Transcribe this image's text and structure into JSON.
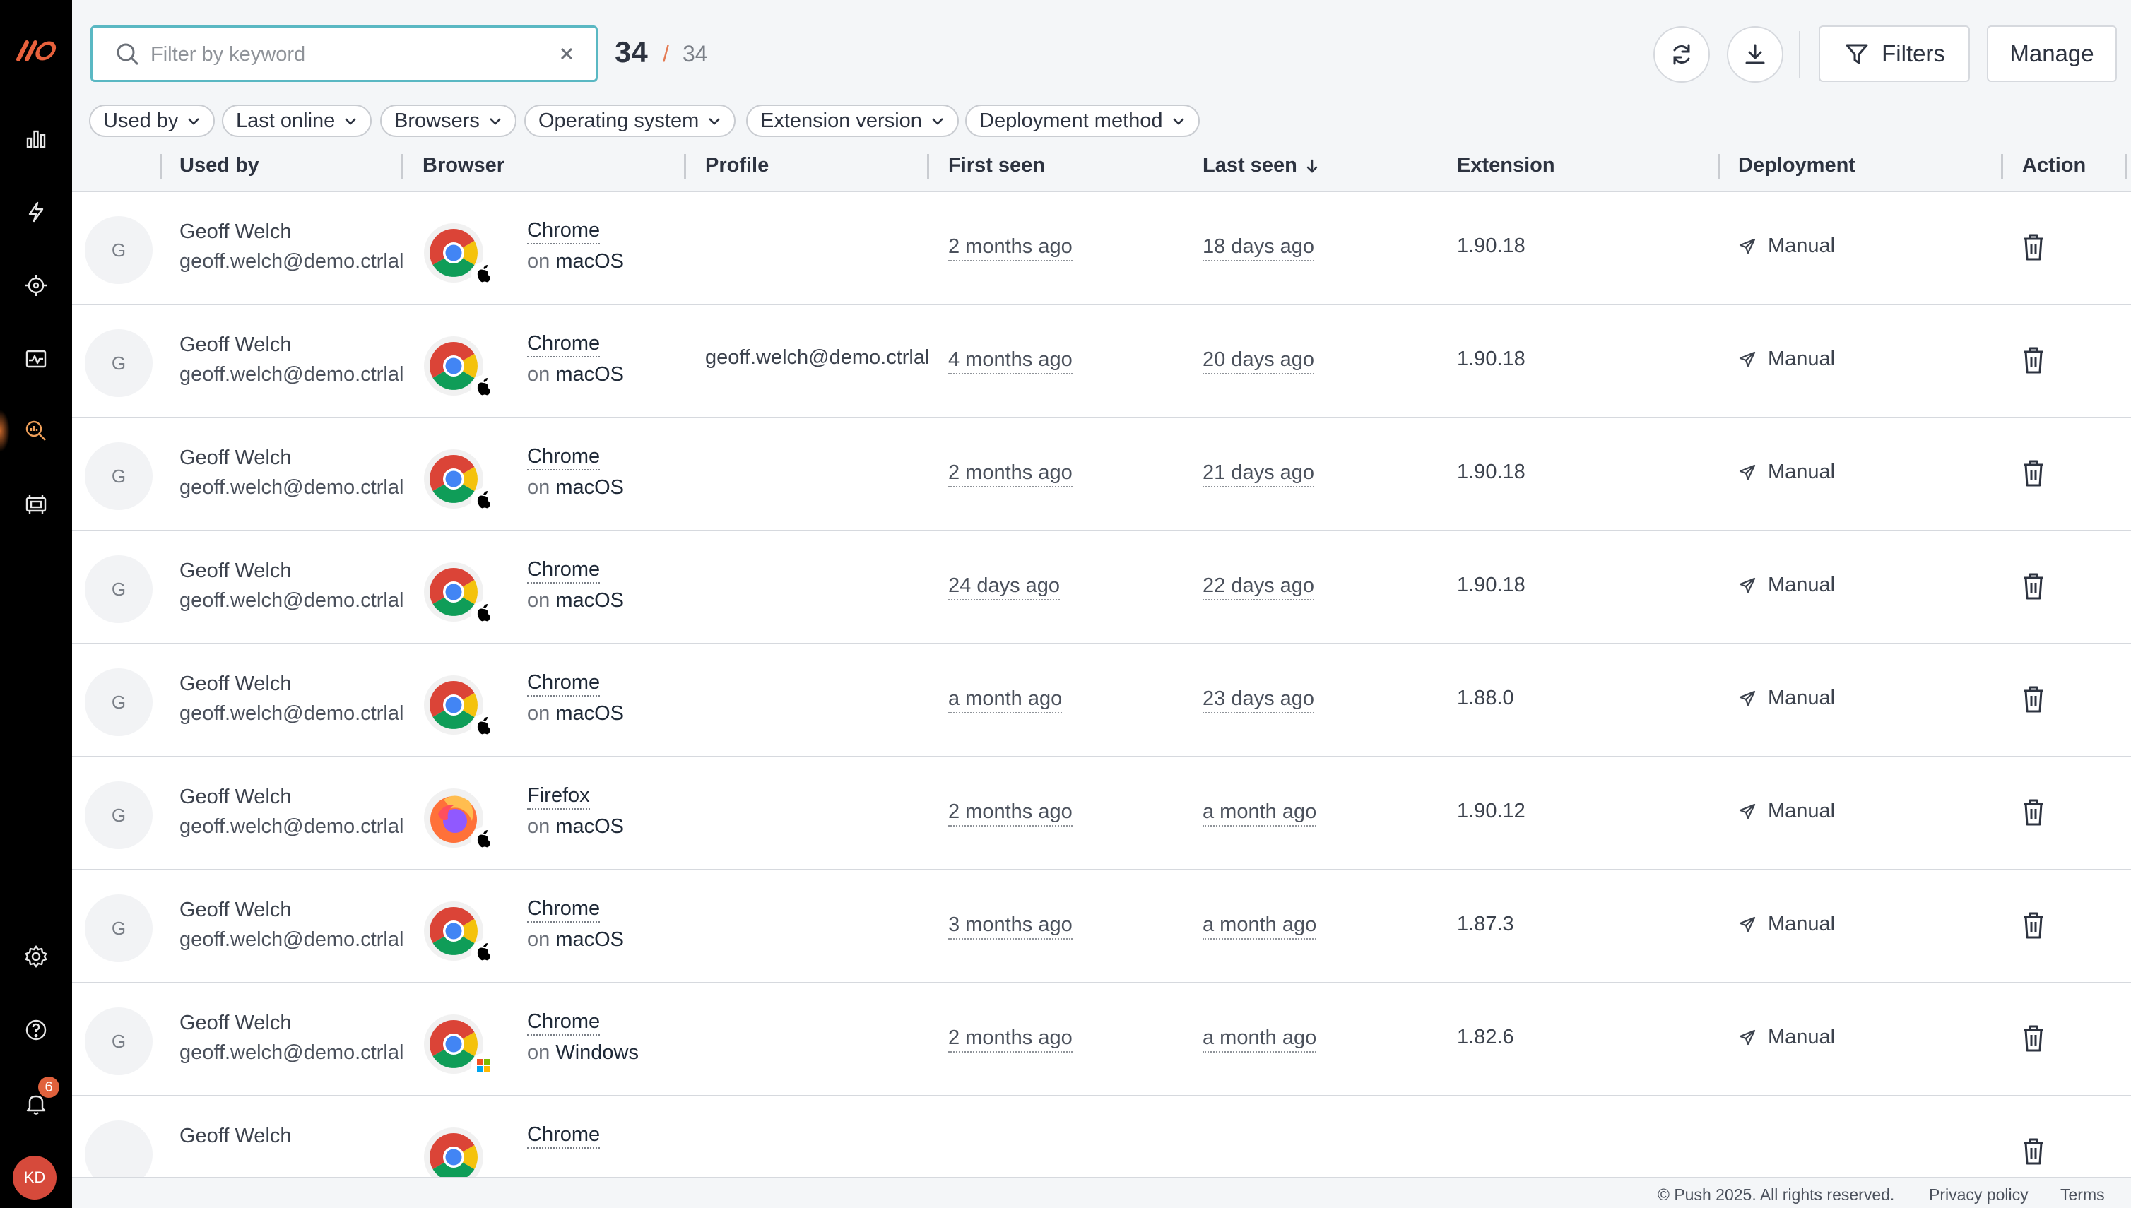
{
  "search": {
    "placeholder": "Filter by keyword",
    "value": ""
  },
  "counts": {
    "shown": "34",
    "separator": "/",
    "total": "34"
  },
  "toolbar": {
    "filters_label": "Filters",
    "manage_label": "Manage"
  },
  "filter_chips": [
    "Used by",
    "Last online",
    "Browsers",
    "Operating system",
    "Extension version",
    "Deployment method"
  ],
  "columns": {
    "used_by": "Used by",
    "browser": "Browser",
    "profile": "Profile",
    "first_seen": "First seen",
    "last_seen": "Last seen",
    "extension": "Extension",
    "deployment": "Deployment",
    "action": "Action"
  },
  "rows": [
    {
      "avatar": "G",
      "name": "Geoff Welch",
      "email": "geoff.welch@demo.ctrlal",
      "browser": "Chrome",
      "on": "on",
      "os": "macOS",
      "profile": "",
      "first_seen": "2 months ago",
      "last_seen": "18 days ago",
      "extension": "1.90.18",
      "deployment": "Manual"
    },
    {
      "avatar": "G",
      "name": "Geoff Welch",
      "email": "geoff.welch@demo.ctrlal",
      "browser": "Chrome",
      "on": "on",
      "os": "macOS",
      "profile": "geoff.welch@demo.ctrlal",
      "first_seen": "4 months ago",
      "last_seen": "20 days ago",
      "extension": "1.90.18",
      "deployment": "Manual"
    },
    {
      "avatar": "G",
      "name": "Geoff Welch",
      "email": "geoff.welch@demo.ctrlal",
      "browser": "Chrome",
      "on": "on",
      "os": "macOS",
      "profile": "",
      "first_seen": "2 months ago",
      "last_seen": "21 days ago",
      "extension": "1.90.18",
      "deployment": "Manual"
    },
    {
      "avatar": "G",
      "name": "Geoff Welch",
      "email": "geoff.welch@demo.ctrlal",
      "browser": "Chrome",
      "on": "on",
      "os": "macOS",
      "profile": "",
      "first_seen": "24 days ago",
      "last_seen": "22 days ago",
      "extension": "1.90.18",
      "deployment": "Manual"
    },
    {
      "avatar": "G",
      "name": "Geoff Welch",
      "email": "geoff.welch@demo.ctrlal",
      "browser": "Chrome",
      "on": "on",
      "os": "macOS",
      "profile": "",
      "first_seen": "a month ago",
      "last_seen": "23 days ago",
      "extension": "1.88.0",
      "deployment": "Manual"
    },
    {
      "avatar": "G",
      "name": "Geoff Welch",
      "email": "geoff.welch@demo.ctrlal",
      "browser": "Firefox",
      "on": "on",
      "os": "macOS",
      "profile": "",
      "first_seen": "2 months ago",
      "last_seen": "a month ago",
      "extension": "1.90.12",
      "deployment": "Manual"
    },
    {
      "avatar": "G",
      "name": "Geoff Welch",
      "email": "geoff.welch@demo.ctrlal",
      "browser": "Chrome",
      "on": "on",
      "os": "macOS",
      "profile": "",
      "first_seen": "3 months ago",
      "last_seen": "a month ago",
      "extension": "1.87.3",
      "deployment": "Manual"
    },
    {
      "avatar": "G",
      "name": "Geoff Welch",
      "email": "geoff.welch@demo.ctrlal",
      "browser": "Chrome",
      "on": "on",
      "os": "Windows",
      "profile": "",
      "first_seen": "2 months ago",
      "last_seen": "a month ago",
      "extension": "1.82.6",
      "deployment": "Manual"
    },
    {
      "avatar": "",
      "name": "Geoff Welch",
      "email": "",
      "browser": "Chrome",
      "on": "",
      "os": "",
      "profile": "",
      "first_seen": "",
      "last_seen": "",
      "extension": "",
      "deployment": ""
    }
  ],
  "notifications": {
    "count": "6"
  },
  "user": {
    "initials": "KD"
  },
  "footer": {
    "copyright": "© Push 2025. All rights reserved.",
    "privacy": "Privacy policy",
    "terms": "Terms"
  },
  "colors": {
    "accent_orange": "#e0613c",
    "search_border": "#5ab8c3",
    "sidebar_bg": "#000000"
  }
}
